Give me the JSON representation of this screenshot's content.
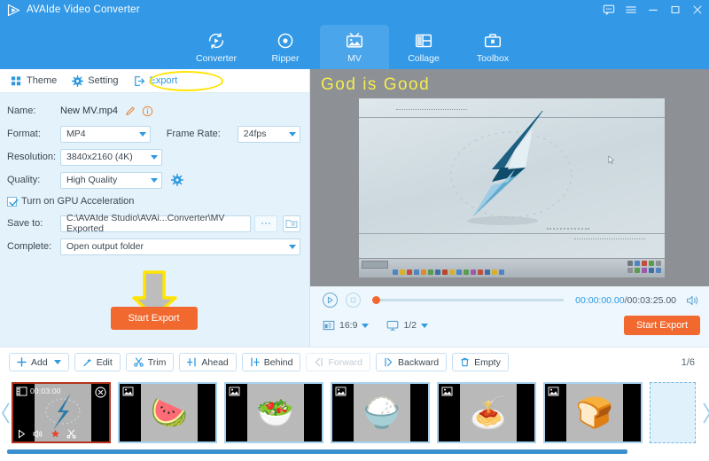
{
  "window": {
    "title": "AVAIde Video Converter",
    "controls": [
      {
        "name": "feedback-icon",
        "glyph": "feedback"
      },
      {
        "name": "menu-icon",
        "glyph": "menu"
      },
      {
        "name": "minimize-icon",
        "glyph": "minimize"
      },
      {
        "name": "maximize-icon",
        "glyph": "maximize"
      },
      {
        "name": "close-icon",
        "glyph": "close"
      }
    ],
    "accent_blue": "#3399e6",
    "accent_orange": "#f1692f",
    "highlight_yellow": "#ffe400"
  },
  "nav": {
    "tabs": [
      {
        "label": "Converter",
        "icon": "converter-icon",
        "active": false
      },
      {
        "label": "Ripper",
        "icon": "ripper-icon",
        "active": false
      },
      {
        "label": "MV",
        "icon": "mv-icon",
        "active": true
      },
      {
        "label": "Collage",
        "icon": "collage-icon",
        "active": false
      },
      {
        "label": "Toolbox",
        "icon": "toolbox-icon",
        "active": false
      }
    ]
  },
  "subtabs": [
    {
      "label": "Theme",
      "icon": "theme-grid-icon",
      "active": false
    },
    {
      "label": "Setting",
      "icon": "setting-gear-icon",
      "active": false
    },
    {
      "label": "Export",
      "icon": "export-arrow-icon",
      "active": true,
      "highlighted": true
    }
  ],
  "export_form": {
    "name_label": "Name:",
    "name_value": "New MV.mp4",
    "edit_icon": "pencil-icon",
    "info_icon": "info-icon",
    "format_label": "Format:",
    "format_value": "MP4",
    "frame_rate_label": "Frame Rate:",
    "frame_rate_value": "24fps",
    "resolution_label": "Resolution:",
    "resolution_value": "3840x2160 (4K)",
    "quality_label": "Quality:",
    "quality_value": "High Quality",
    "quality_settings_icon": "gear-icon",
    "gpu_label": "Turn on GPU Acceleration",
    "gpu_checked": true,
    "save_to_label": "Save to:",
    "save_to_value": "C:\\AVAIde Studio\\AVAi...Converter\\MV Exported",
    "browse_dots": "···",
    "folder_icon": "folder-icon",
    "complete_label": "Complete:",
    "complete_value": "Open output folder",
    "start_export_label": "Start Export",
    "arrow_hint": "down-arrow-pointer"
  },
  "preview": {
    "mv_title_text": "God is Good",
    "title_color": "#f5ed4f",
    "scene_description": "windows-desktop-lightning-bolt-wallpaper"
  },
  "player": {
    "play_icon": "play-icon",
    "stop_icon": "stop-icon",
    "current_time": "00:00:00.00",
    "separator": "/",
    "total_time": "00:03:25.00",
    "volume_icon": "volume-icon",
    "aspect_icon": "aspect-ratio-icon",
    "aspect_value": "16:9",
    "screen_icon": "screen-icon",
    "screen_value": "1/2",
    "start_export_label": "Start Export",
    "progress_percent": 0
  },
  "toolbar": {
    "buttons": [
      {
        "label": "Add",
        "icon": "plus-icon",
        "has_caret": true,
        "disabled": false
      },
      {
        "label": "Edit",
        "icon": "edit-wand-icon",
        "has_caret": false,
        "disabled": false
      },
      {
        "label": "Trim",
        "icon": "scissors-icon",
        "has_caret": false,
        "disabled": false
      },
      {
        "label": "Ahead",
        "icon": "insert-ahead-icon",
        "has_caret": false,
        "disabled": false
      },
      {
        "label": "Behind",
        "icon": "insert-behind-icon",
        "has_caret": false,
        "disabled": false
      },
      {
        "label": "Forward",
        "icon": "move-forward-icon",
        "has_caret": false,
        "disabled": true
      },
      {
        "label": "Backward",
        "icon": "move-backward-icon",
        "has_caret": false,
        "disabled": false
      },
      {
        "label": "Empty",
        "icon": "trash-icon",
        "has_caret": false,
        "disabled": false
      }
    ],
    "page_counter": "1/6"
  },
  "timeline": {
    "prev_arrow": "chevron-left-icon",
    "next_arrow": "chevron-right-icon",
    "clips": [
      {
        "type": "video",
        "duration": "00:03:00",
        "selected": true,
        "thumb": "lightning-bolt-desktop",
        "controls": [
          "play-icon",
          "volume-icon",
          "effects-icon",
          "scissors-icon"
        ],
        "close": "close-icon"
      },
      {
        "type": "image",
        "badge": "image-icon",
        "selected": false,
        "thumb": "fruit-plate",
        "glyph": "🍉"
      },
      {
        "type": "image",
        "badge": "image-icon",
        "selected": false,
        "thumb": "vegetable-bowl",
        "glyph": "🥗"
      },
      {
        "type": "image",
        "badge": "image-icon",
        "selected": false,
        "thumb": "rice-bowl",
        "glyph": "🍚"
      },
      {
        "type": "image",
        "badge": "image-icon",
        "selected": false,
        "thumb": "pasta-dish",
        "glyph": "🍝"
      },
      {
        "type": "image",
        "badge": "image-icon",
        "selected": false,
        "thumb": "bread-slices",
        "glyph": "🍞"
      }
    ],
    "add_placeholder": true,
    "scroll_position": 0
  }
}
